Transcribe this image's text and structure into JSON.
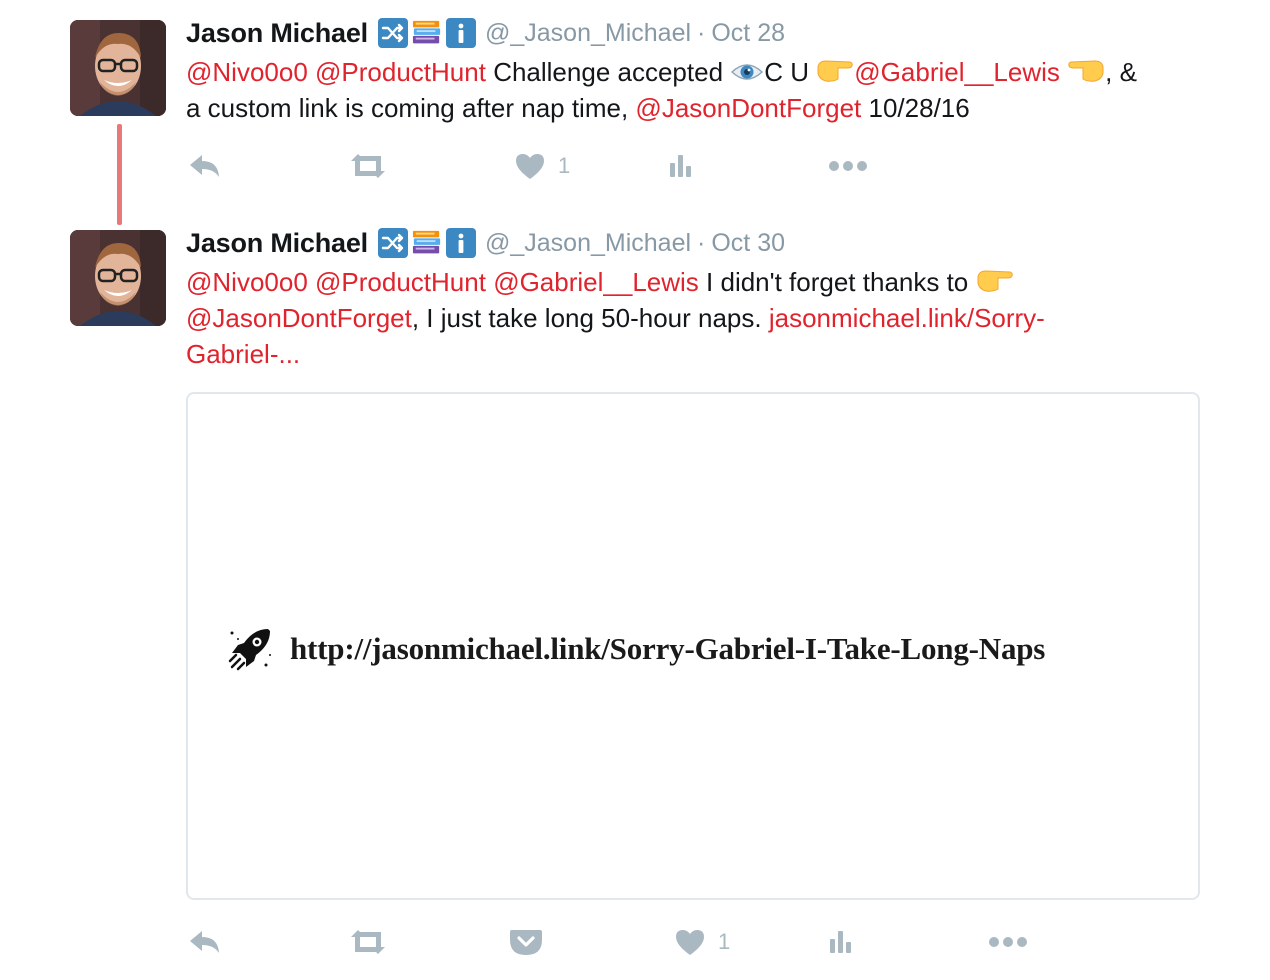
{
  "tweets": [
    {
      "author_name": "Jason Michael",
      "handle": "@_Jason_Michael",
      "separator": "·",
      "date": "Oct 28",
      "text_line1": {
        "mention1": "@Nivo0o0",
        "mention2": "@ProductHunt",
        "text1": "Challenge accepted",
        "text2": "C U",
        "mention3": "@Gabriel__Lewis",
        "text3": ", &"
      },
      "text_line2": {
        "text1": "a custom link is coming after nap time,",
        "mention1": "@JasonDontForget",
        "text2": "10/28/16"
      },
      "like_count": "1"
    },
    {
      "author_name": "Jason Michael",
      "handle": "@_Jason_Michael",
      "separator": "·",
      "date": "Oct 30",
      "text_line1": {
        "mention1": "@Nivo0o0",
        "mention2": "@ProductHunt",
        "mention3": "@Gabriel__Lewis",
        "text1": "I didn't forget thanks to"
      },
      "text_line2": {
        "mention1": "@JasonDontForget",
        "text1": ", I just take long 50-hour naps.",
        "link1": "jasonmichael.link/Sorry-"
      },
      "text_line3": {
        "link1": "Gabriel-..."
      },
      "card": {
        "icon": "rocket-icon",
        "url_text": "http://jasonmichael.link/Sorry-Gabriel-I-Take-Long-Naps"
      },
      "like_count": "1"
    }
  ],
  "colors": {
    "mention": "#e0242e",
    "meta": "#8899a6",
    "action_icon": "#aab8c2",
    "thread_line": "#e8787a"
  },
  "icons": [
    "shuffle-icon",
    "books-icon",
    "info-icon",
    "eye-icon",
    "pointing-right-icon",
    "pointing-left-icon",
    "reply-icon",
    "retweet-icon",
    "heart-icon",
    "analytics-icon",
    "more-icon",
    "pocket-icon",
    "rocket-icon"
  ]
}
